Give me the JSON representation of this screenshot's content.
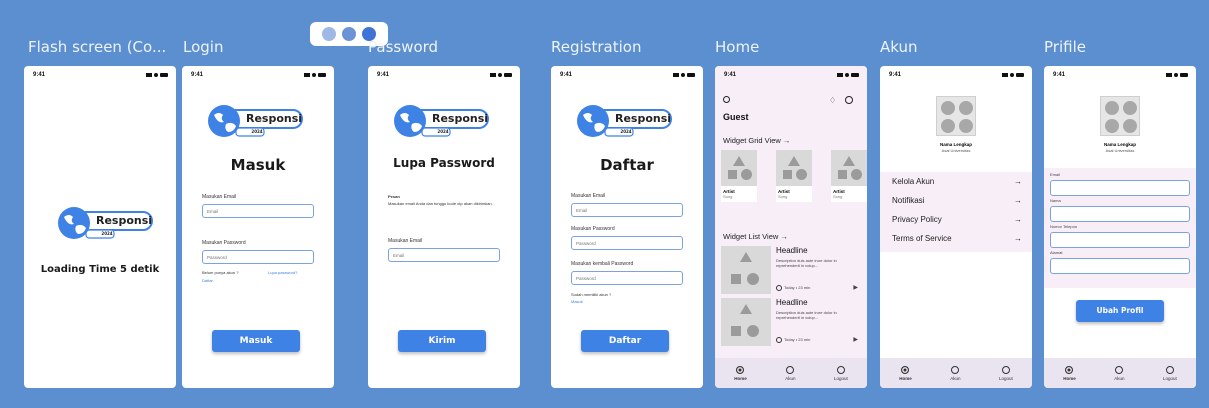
{
  "window_controls": [
    "dot-1",
    "dot-2",
    "dot-3"
  ],
  "frames": {
    "flash": "Flash screen (Co...",
    "login": "Login",
    "password": "Password",
    "registration": "Registration",
    "home": "Home",
    "akun": "Akun",
    "profile": "Prifile"
  },
  "status_time": "9:41",
  "logo": {
    "name": "Responsi",
    "year": "2024"
  },
  "flash": {
    "loading": "Loading Time 5 detik"
  },
  "login": {
    "title": "Masuk",
    "email_label": "Masukan Email",
    "email_placeholder": "Email",
    "password_label": "Masukan Password",
    "password_placeholder": "Password",
    "no_account": "Belum punya akun ?",
    "forgot": "Lupa password?",
    "register_link": "Daftar",
    "button": "Masuk"
  },
  "password": {
    "title": "Lupa Password",
    "info_title": "Pesan",
    "info_text": "Masukan email Anda dan tunggu kode otp akan dikirimkan.",
    "email_label": "Masukan Email",
    "email_placeholder": "Email",
    "button": "Kirim"
  },
  "registration": {
    "title": "Daftar",
    "email_label": "Masukan Email",
    "email_placeholder": "Email",
    "password_label": "Masukan Password",
    "password_placeholder": "Password",
    "confirm_label": "Masukan kembali Password",
    "confirm_placeholder": "Password",
    "has_account": "Sudah memiliki akun ?",
    "login_link": "Masuk",
    "button": "Daftar"
  },
  "home": {
    "greeting": "Guest",
    "grid_title": "Widget Grid View",
    "grid_cards": [
      {
        "title": "Artist",
        "sub": "Song"
      },
      {
        "title": "Artist",
        "sub": "Song"
      },
      {
        "title": "Artist",
        "sub": "Song"
      }
    ],
    "list_title": "Widget List View",
    "list_items": [
      {
        "headline": "Headline",
        "desc": "Description duis aute irure dolor in reprehenderit in volup...",
        "meta": "Today • 23 min"
      },
      {
        "headline": "Headline",
        "desc": "Description duis aute irure dolor in reprehenderit in volup...",
        "meta": "Today • 23 min"
      }
    ]
  },
  "akun": {
    "name": "Nama Lengkap",
    "university": "Asal Universitas",
    "menu": [
      "Kelola Akun",
      "Notifikasi",
      "Privacy Policy",
      "Terms of Service"
    ]
  },
  "profile": {
    "name": "Nama Lengkap",
    "university": "Asal Universitas",
    "fields": [
      "Email",
      "Nama",
      "Nomor Telepon",
      "Alamat"
    ],
    "button": "Ubah Profil"
  },
  "nav_home": [
    "Home",
    "Akun",
    "Logout"
  ],
  "nav_akun": [
    "Home",
    "Akun",
    "Logout"
  ],
  "colors": {
    "background": "#5c8fcf",
    "accent": "#3f82e6",
    "nav": "#eae4f1"
  }
}
